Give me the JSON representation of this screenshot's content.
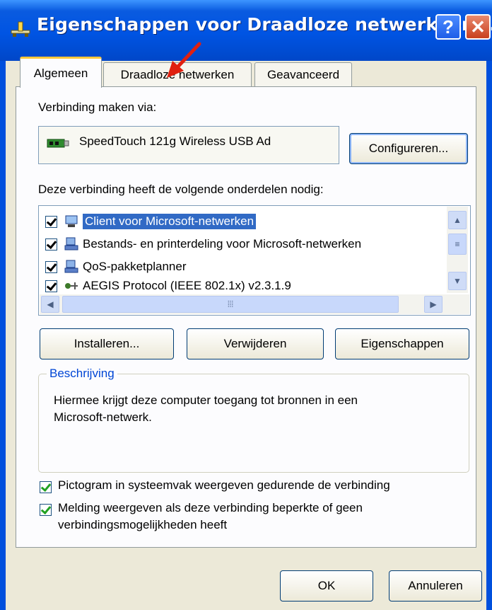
{
  "window": {
    "title": "Eigenschappen voor Draadloze netwerkverbi...",
    "help": "?",
    "close": "✕"
  },
  "tabs": [
    "Algemeen",
    "Draadloze netwerken",
    "Geavanceerd"
  ],
  "connect_via": {
    "label": "Verbinding maken via:",
    "adapter": "SpeedTouch 121g Wireless USB Ad",
    "configure_button": "Configureren..."
  },
  "components": {
    "label": "Deze verbinding heeft de volgende onderdelen nodig:",
    "items": [
      {
        "label": "Client voor Microsoft-netwerken",
        "checked": true,
        "selected": true
      },
      {
        "label": "Bestands- en printerdeling voor Microsoft-netwerken",
        "checked": true
      },
      {
        "label": "QoS-pakketplanner",
        "checked": true
      },
      {
        "label": "AEGIS Protocol (IEEE 802.1x) v2.3.1.9",
        "checked": true
      }
    ]
  },
  "buttons": {
    "install": "Installeren...",
    "remove": "Verwijderen",
    "properties": "Eigenschappen"
  },
  "description": {
    "title": "Beschrijving",
    "text_line1": "Hiermee krijgt deze computer toegang tot bronnen in een",
    "text_line2": "Microsoft-netwerk."
  },
  "options": {
    "tray_icon": "Pictogram in systeemvak weergeven gedurende de verbinding",
    "notify_line1": "Melding weergeven als deze verbinding beperkte of geen",
    "notify_line2": "verbindingsmogelijkheden heeft"
  },
  "footer": {
    "ok": "OK",
    "cancel": "Annuleren"
  },
  "colors": {
    "titlebar": "#0054e3",
    "selection": "#316ac5",
    "accent_tab": "#ffc83c",
    "arrow": "#e02010"
  },
  "icons": [
    "network-connection-icon",
    "help-icon",
    "close-icon",
    "network-adapter-icon",
    "network-client-icon",
    "network-service-icon",
    "protocol-icon",
    "red-arrow-annotation"
  ]
}
